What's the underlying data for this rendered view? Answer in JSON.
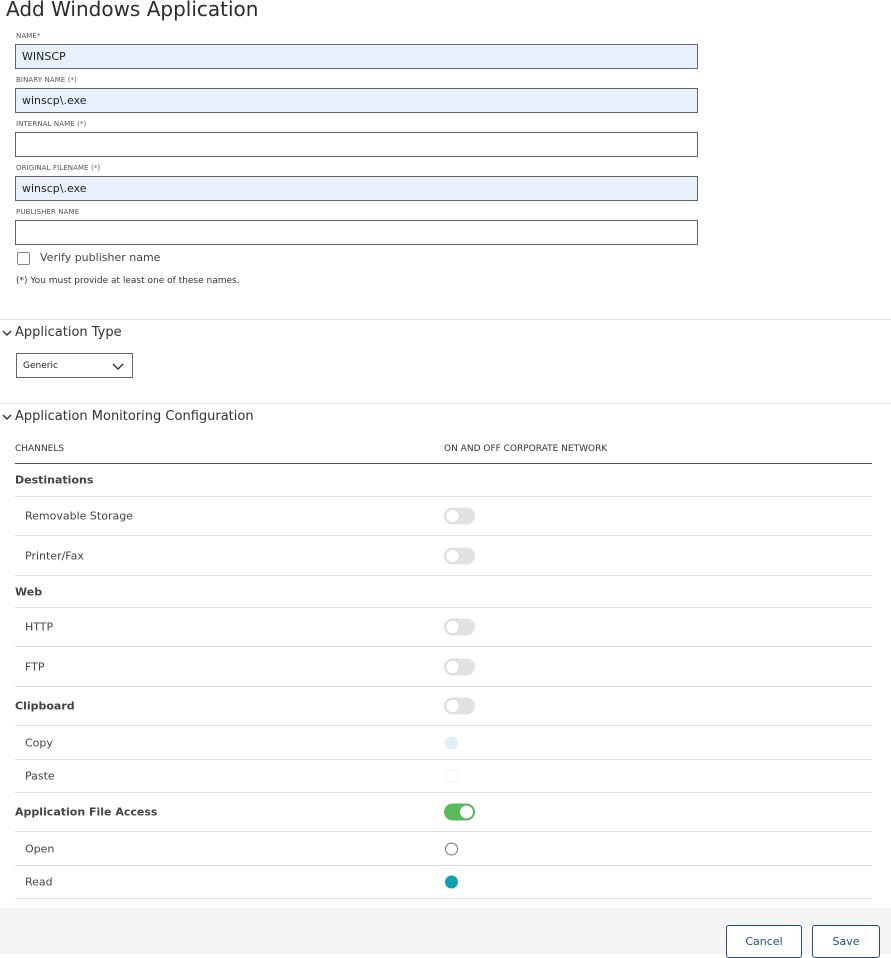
{
  "page": {
    "title": "Add Windows Application"
  },
  "form": {
    "name": {
      "label": "NAME*",
      "value": "WINSCP"
    },
    "binary_name": {
      "label": "BINARY NAME (*)",
      "value": "winscp\\.exe"
    },
    "internal_name": {
      "label": "INTERNAL NAME (*)",
      "value": ""
    },
    "original_filename": {
      "label": "ORIGINAL FILENAME (*)",
      "value": "winscp\\.exe"
    },
    "publisher_name": {
      "label": "PUBLISHER NAME",
      "value": ""
    },
    "verify_publisher": {
      "label": "Verify publisher name",
      "checked": false
    },
    "note": "(*) You must provide at least one of these names."
  },
  "app_type": {
    "heading": "Application Type",
    "selected": "Generic"
  },
  "monitoring": {
    "heading": "Application Monitoring Configuration",
    "col_channels": "CHANNELS",
    "col_network": "ON AND OFF CORPORATE NETWORK",
    "rows": [
      {
        "label": "Destinations",
        "kind": "group",
        "control": "none"
      },
      {
        "label": "Removable Storage",
        "kind": "item",
        "control": "toggle",
        "on": false
      },
      {
        "label": "Printer/Fax",
        "kind": "item",
        "control": "toggle",
        "on": false
      },
      {
        "label": "Web",
        "kind": "group",
        "control": "none"
      },
      {
        "label": "HTTP",
        "kind": "item",
        "control": "toggle",
        "on": false
      },
      {
        "label": "FTP",
        "kind": "item",
        "control": "toggle",
        "on": false
      },
      {
        "label": "Clipboard",
        "kind": "group",
        "control": "toggle",
        "on": false
      },
      {
        "label": "Copy",
        "kind": "item",
        "control": "radio",
        "state": "disabled-selected"
      },
      {
        "label": "Paste",
        "kind": "item",
        "control": "radio",
        "state": "disabled"
      },
      {
        "label": "Application File Access",
        "kind": "group",
        "control": "toggle",
        "on": true
      },
      {
        "label": "Open",
        "kind": "item",
        "control": "radio",
        "state": "unselected"
      },
      {
        "label": "Read",
        "kind": "item",
        "control": "radio",
        "state": "selected"
      }
    ]
  },
  "footer": {
    "cancel_label": "Cancel",
    "save_label": "Save"
  },
  "colors": {
    "accent": "#0f9fb0",
    "toggle_on": "#5cb85c",
    "button_border": "#1f4e8c",
    "filled_input": "#e8f0fe"
  }
}
